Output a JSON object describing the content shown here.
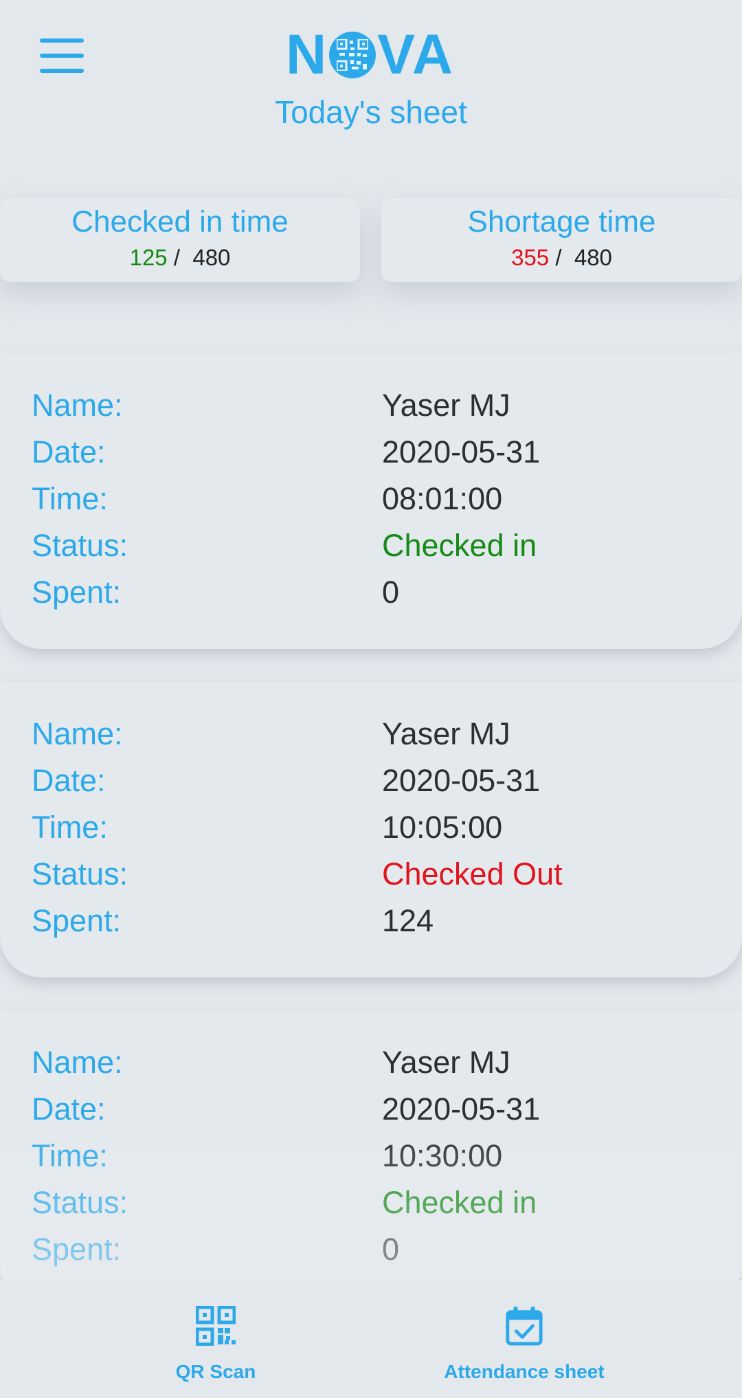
{
  "app": {
    "logo_text_left": "N",
    "logo_text_right": "VA",
    "page_title": "Today's sheet"
  },
  "summary": {
    "checked_in": {
      "title": "Checked in time",
      "value": "125",
      "separator": "/",
      "total": "480"
    },
    "shortage": {
      "title": "Shortage time",
      "value": "355",
      "separator": "/",
      "total": "480"
    }
  },
  "labels": {
    "name": "Name:",
    "date": "Date:",
    "time": "Time:",
    "status": "Status:",
    "spent": "Spent:"
  },
  "records": [
    {
      "name": "Yaser MJ",
      "date": "2020-05-31",
      "time": "08:01:00",
      "status": "Checked in",
      "spent": "0"
    },
    {
      "name": "Yaser MJ",
      "date": "2020-05-31",
      "time": "10:05:00",
      "status": "Checked Out",
      "spent": "124"
    },
    {
      "name": "Yaser MJ",
      "date": "2020-05-31",
      "time": "10:30:00",
      "status": "Checked in",
      "spent": "0"
    }
  ],
  "bottom_nav": {
    "qr_label": "QR Scan",
    "attendance_label": "Attendance sheet"
  },
  "colors": {
    "accent": "#2ba9ea",
    "checked_in": "#158a15",
    "checked_out": "#e2131a",
    "background": "#e3e8ec"
  },
  "icons": [
    "menu-icon",
    "qr-code-icon",
    "calendar-check-icon"
  ]
}
